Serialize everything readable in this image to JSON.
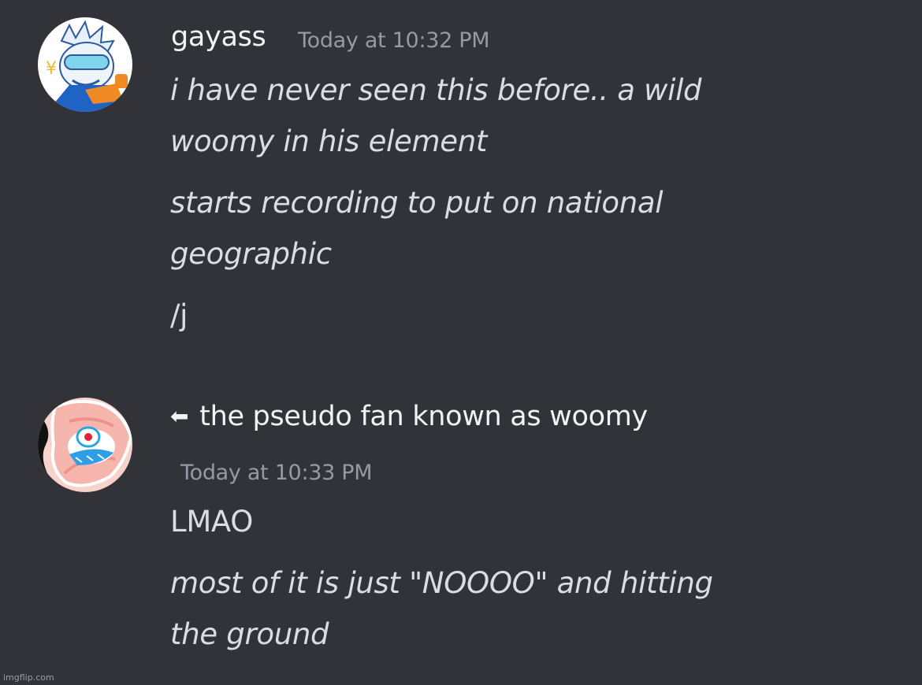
{
  "messages": [
    {
      "username": "gayass",
      "timestamp": "Today at 10:32 PM",
      "avatar_icon": "blue-white-character-avatar-icon",
      "lines": [
        "i have never seen this before.. a wild",
        "woomy in his element",
        "starts recording to put on national",
        "geographic",
        "/j"
      ]
    },
    {
      "username_prefix": "⬅",
      "username": "the pseudo fan known as woomy",
      "timestamp": "Today at 10:33 PM",
      "avatar_icon": "pink-character-avatar-icon",
      "lines": [
        "LMAO",
        "most of it is just \"NOOOO\" and hitting",
        "the ground"
      ]
    }
  ],
  "watermark": "imgflip.com",
  "colors": {
    "background": "#313338",
    "username": "#f2f3f5",
    "timestamp": "#949ba4",
    "text": "#dbdee1"
  }
}
